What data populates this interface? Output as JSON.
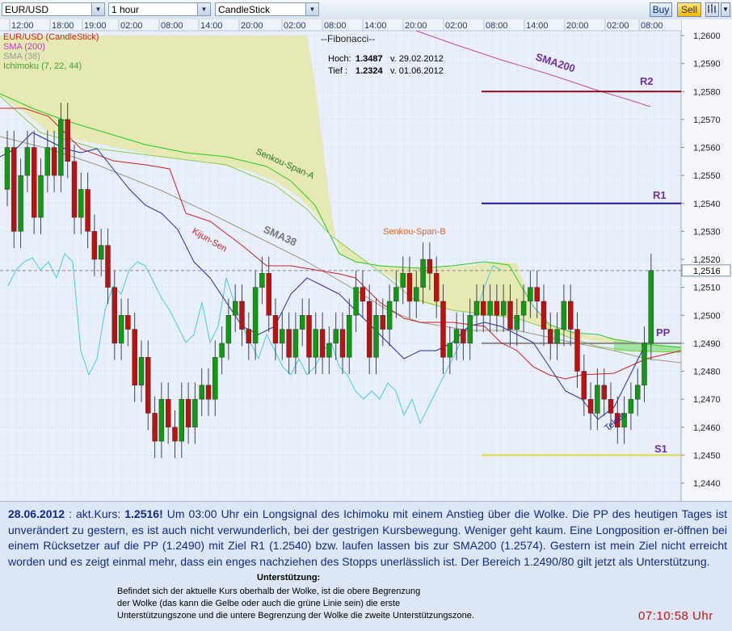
{
  "toolbar": {
    "symbol": "EUR/USD",
    "timeframe": "1 hour",
    "chart_type": "CandleStick",
    "buy_label": "Buy",
    "sell_label": "Sell",
    "chart_icon": "bar-chart-icon",
    "dropdown_icon": "chevron-down-icon"
  },
  "chart": {
    "time_labels": [
      "12:00",
      "18:00",
      "19:00",
      "02:00",
      "08:00",
      "14:00",
      "20:00",
      "02:00",
      "08:00",
      "14:00",
      "20:00",
      "02:00",
      "08:00",
      "14:00",
      "20:00",
      "02:00",
      "08:00"
    ],
    "price_labels": [
      "1,2600",
      "1,2590",
      "1,2580",
      "1,2570",
      "1,2560",
      "1,2550",
      "1,2540",
      "1,2530",
      "1,2520",
      "1,2510",
      "1,2500",
      "1,2490",
      "1,2480",
      "1,2470",
      "1,2460",
      "1,2450",
      "1,2440"
    ],
    "current_price_label": "1,2516",
    "legend": [
      {
        "text": "EUR/USD (CandleStick)",
        "color": "#cc2222"
      },
      {
        "text": "SMA (200)",
        "color": "#cc33cc"
      },
      {
        "text": "SMA (38)",
        "color": "#999999"
      },
      {
        "text": "Ichimoku (7, 22, 44)",
        "color": "#33aa33"
      }
    ],
    "fibonacci": {
      "title": "--Fibonacci--",
      "high_label": "Hoch:",
      "high_value": "1.3487",
      "high_date": "v. 29.02.2012",
      "low_label": "Tief :",
      "low_value": "1.2324",
      "low_date": "v. 01.06.2012"
    },
    "annotations": {
      "sma200": "SMA200",
      "sma38": "SMA38",
      "senkou_a": "Senkou-Span-A",
      "senkou_b": "Senkou-Span-B",
      "kijun": "Kijun-Sen",
      "tekan": "Tekan",
      "r2": "R2",
      "r1": "R1",
      "pp": "PP",
      "s1": "S1"
    },
    "colors": {
      "background": "#e9effb",
      "cloud": "#e5e8a6",
      "cloud_green": "#8ee08e",
      "candle_green": "#119911",
      "candle_red": "#bb1111",
      "r2": "#8b0d1d",
      "r1": "#1a1aa0",
      "pp": "#8a8a8a",
      "s1": "#d8d84a",
      "sma200": "#c64aa8",
      "sma38": "#9a9a7a",
      "kijun": "#cc2020",
      "tenkan": "#1f2fa0",
      "chikou": "#44cce0",
      "senkou": "#22cc22",
      "label_purple": "#7030a0"
    }
  },
  "info": {
    "date": "28.06.2012",
    "price_prefix": "akt.Kurs:",
    "price": "1.2516!",
    "body": "Um 03:00 Uhr ein Longsignal des Ichimoku mit einem Anstieg über die Wolke. Die PP des heutigen Tages ist unverändert zu gestern, es ist auch nicht verwunderlich, bei der gestrigen Kursbewegung. Weniger geht kaum. Eine Longposition er-öffnen bei einem Rücksetzer auf die PP (1.2490) mit Ziel R1 (1.2540) bzw. laufen lassen bis zur SMA200 (1.2574). Gestern ist mein Ziel nicht erreicht worden und es zeigt einmal mehr, dass ein enges nachziehen des Stopps unerlässlich ist. Der Bereich 1.2490/80 gilt jetzt als Unterstützung.",
    "support_title": "Unterstützung:",
    "support_lines": [
      "Befindet sich der aktuelle Kurs oberhalb der Wolke, ist die obere Begrenzung",
      "der Wolke (das kann die Gelbe oder auch die grüne Linie sein) die erste",
      "Unterstützungszone  und die untere Begrenzung der Wolke die zweite Unterstützungszone."
    ],
    "clock": "07:10:58 Uhr"
  }
}
